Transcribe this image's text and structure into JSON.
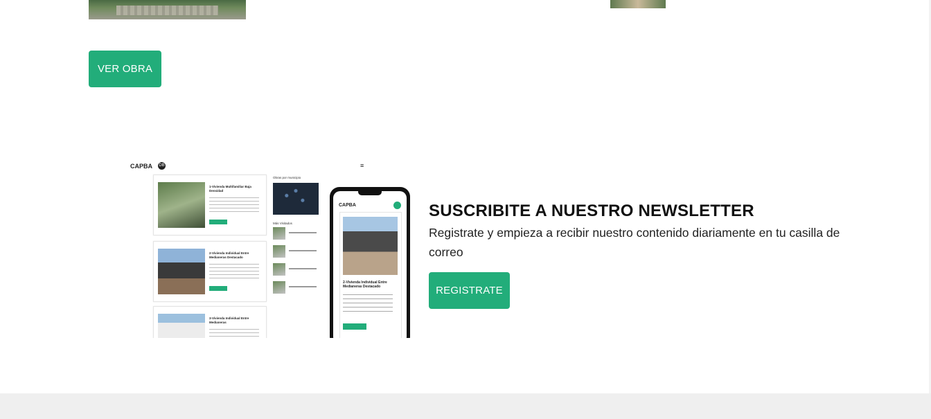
{
  "project_section": {
    "ver_obra_label": "VER OBRA"
  },
  "mockup": {
    "desktop_logo": "CAPBA",
    "desktop_logo_badge": "DB",
    "cards": [
      {
        "title": "1-Vivienda Multifamiliar Baja Densidad"
      },
      {
        "title": "2-Vivienda Individual Entre Medianeras Destacado"
      },
      {
        "title": "3-Vivienda Individual Entre Medianeras"
      }
    ],
    "sidebar_title": "Obras por municipio",
    "sidebar_title2": "Más Visitados",
    "phone_logo": "CAPBA",
    "phone_card_title": "2-Vivienda Individual Entre Medianeras Destacado"
  },
  "newsletter": {
    "title": "SUSCRIBITE A NUESTRO NEWSLETTER",
    "text": "Registrate y empieza a recibir nuestro contenido diariamente en tu casilla de correo",
    "button_label": "REGISTRATE",
    "accent_color": "#22ad7a"
  }
}
